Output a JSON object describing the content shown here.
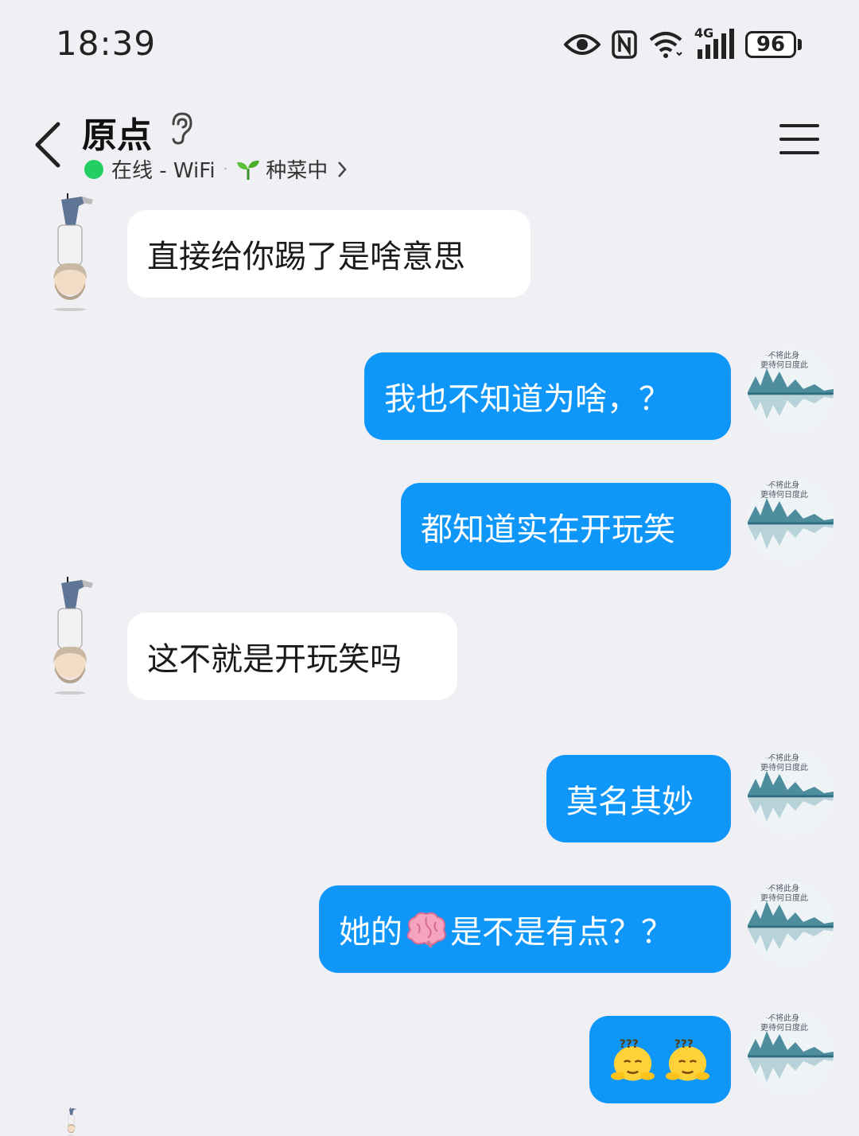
{
  "status_bar": {
    "time": "18:39",
    "network": "4G",
    "battery": "96"
  },
  "header": {
    "contact_name": "原点",
    "status": "在线 - WiFi",
    "activity": "种菜中",
    "icons": [
      "back-arrow-icon",
      "ear-icon",
      "sprout-icon",
      "chevron-right-icon",
      "menu-icon"
    ]
  },
  "avatars": {
    "me_text_line1": "不将此身",
    "me_text_line2": "更待何日度此"
  },
  "messages": [
    {
      "side": "in",
      "text": "直接给你踢了是啥意思"
    },
    {
      "side": "out",
      "text": "我也不知道为啥，？"
    },
    {
      "side": "out",
      "text": "都知道实在开玩笑"
    },
    {
      "side": "in",
      "text": "这不就是开玩笑吗"
    },
    {
      "side": "out",
      "text": "莫名其妙"
    },
    {
      "side": "out",
      "text_before": "她的",
      "emoji": "brain",
      "text_after": "是不是有点？？"
    },
    {
      "side": "out",
      "emoji": "confused-face",
      "count": 2
    }
  ]
}
